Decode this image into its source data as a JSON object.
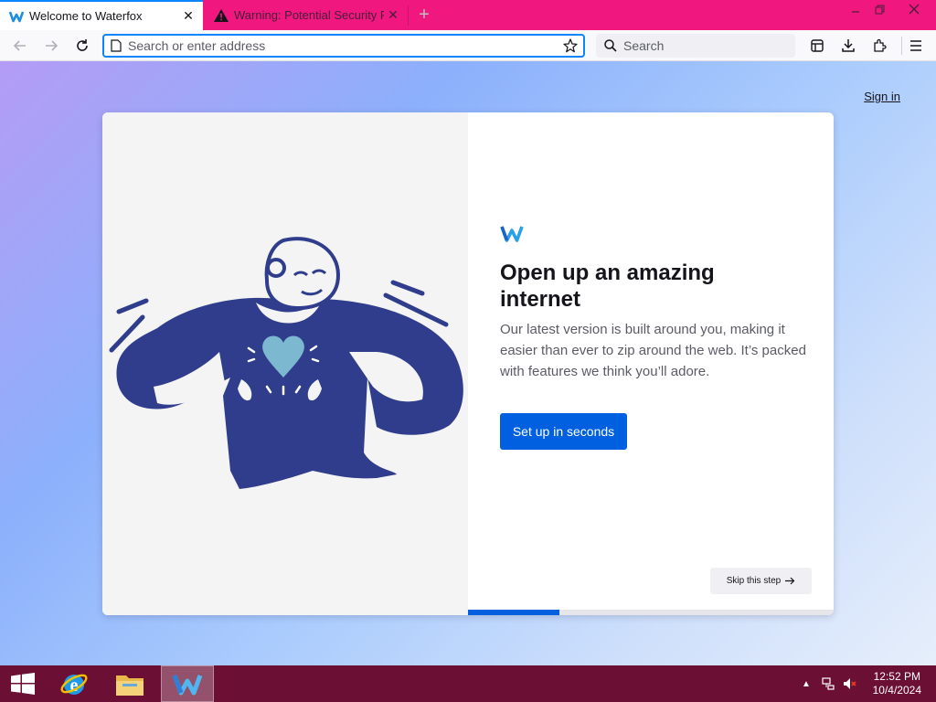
{
  "tabs": [
    {
      "title": "Welcome to Waterfox",
      "icon": "waterfox-icon",
      "active": true
    },
    {
      "title": "Warning: Potential Security Risk Ahead",
      "icon": "warning-icon",
      "active": false
    }
  ],
  "urlbar": {
    "placeholder": "Search or enter address"
  },
  "searchbar": {
    "placeholder": "Search"
  },
  "page": {
    "signin": "Sign in",
    "headline": "Open up an amazing internet",
    "subtitle": "Our latest version is built around you, making it easier than ever to zip around the web. It’s packed with features we think you’ll adore.",
    "primary_button": "Set up in seconds",
    "skip_button": "Skip this step",
    "progress_fraction": 0.25
  },
  "taskbar": {
    "time": "12:52 PM",
    "date": "10/4/2024",
    "items": [
      "start-button",
      "internet-explorer-icon",
      "file-explorer-icon",
      "waterfox-icon"
    ]
  },
  "colors": {
    "tab_strip": "#f0177f",
    "accent_blue": "#0060df",
    "taskbar": "#6b0f34",
    "illustration": "#2f3d8c",
    "heart": "#7cb8d0"
  }
}
